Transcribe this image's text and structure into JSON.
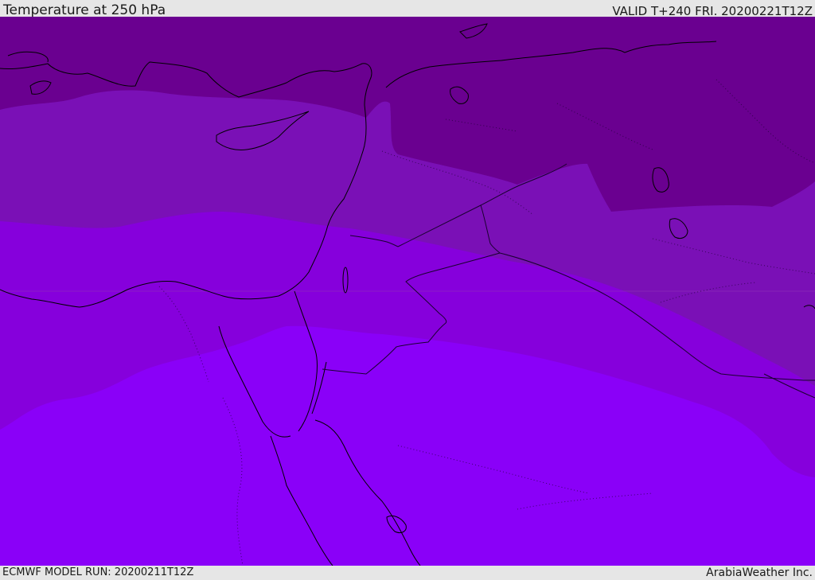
{
  "header": {
    "title": "Temperature at 250 hPa",
    "valid": "VALID T+240 FRI. 20200221T12Z"
  },
  "footer": {
    "model_run": "ECMWF MODEL RUN: 20200211T12Z",
    "credit": "ArabiaWeather Inc."
  },
  "map": {
    "field": "Temperature at 250 hPa",
    "band_colors": [
      "#6a0090",
      "#7a10b6",
      "#8600dc",
      "#8a00f8"
    ]
  }
}
